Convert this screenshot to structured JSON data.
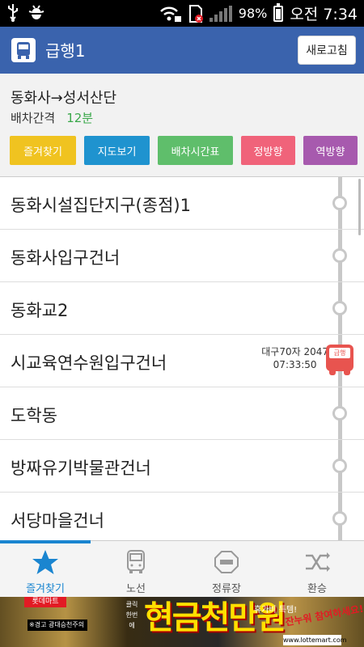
{
  "status_bar": {
    "battery": "98%",
    "time": "오전 7:34"
  },
  "header": {
    "title": "급행1",
    "refresh_label": "새로고침"
  },
  "route": {
    "name": "동화사→성서산단",
    "interval_label": "배차간격",
    "interval_value": "12분"
  },
  "actions": {
    "favorite": "즐겨찾기",
    "map": "지도보기",
    "timetable": "배차시간표",
    "forward": "정방향",
    "reverse": "역방향"
  },
  "stops": [
    {
      "name": "동화시설집단지구(종점)1"
    },
    {
      "name": "동화사입구건너"
    },
    {
      "name": "동화교2"
    },
    {
      "name": "시교육연수원입구건너",
      "bus": {
        "plate": "대구70자 2047",
        "time": "07:33:50",
        "badge": "급행"
      }
    },
    {
      "name": "도학동"
    },
    {
      "name": "방짜유기박물관건너"
    },
    {
      "name": "서당마을건너"
    }
  ],
  "nav": {
    "items": [
      {
        "label": "즐겨찾기",
        "icon": "star-icon",
        "active": true
      },
      {
        "label": "노선",
        "icon": "bus-icon",
        "active": false
      },
      {
        "label": "정류장",
        "icon": "stop-sign-icon",
        "active": false
      },
      {
        "label": "환승",
        "icon": "shuffle-icon",
        "active": false
      }
    ]
  },
  "ad": {
    "brand": "롯데마트",
    "warning": "※경고 광대승천주의",
    "side_text_1": "클릭 한번에",
    "headline": "현금천만원",
    "side_text_2": "휴가비 특템!",
    "promo": "잔누워 참여하세요!",
    "url": "www.lottemart.com"
  },
  "colors": {
    "header": "#3a63ad",
    "accent": "#1a85d0",
    "interval_green": "#3aa84a",
    "favorite_yellow": "#f0c320",
    "map_blue": "#1f93cf",
    "timetable_green": "#5fbe6b",
    "forward_pink": "#f0637a",
    "reverse_purple": "#a75aae",
    "bus_red": "#e8544f"
  }
}
